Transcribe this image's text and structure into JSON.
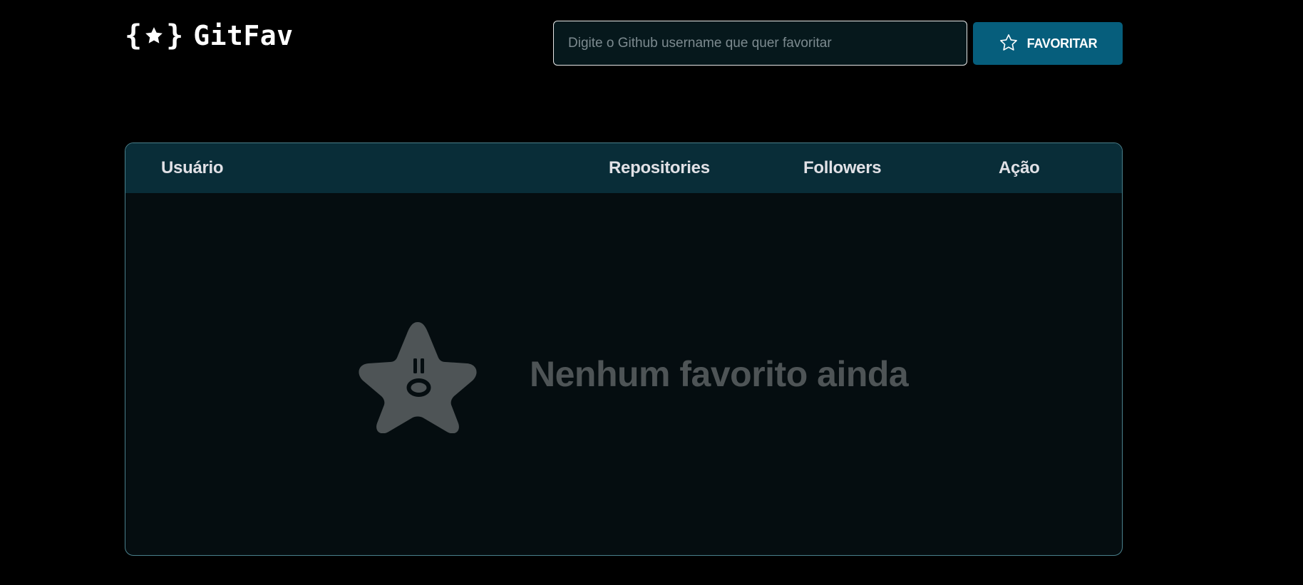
{
  "header": {
    "logo_text": "GitFav",
    "logo_icon": "braces-star-icon",
    "search": {
      "placeholder": "Digite o Github username que quer favoritar",
      "value": ""
    },
    "favorite_button": {
      "label": "FAVORITAR",
      "icon": "star-outline-icon"
    }
  },
  "table": {
    "columns": [
      "Usuário",
      "Repositories",
      "Followers",
      "Ação"
    ],
    "rows": [],
    "empty_state": {
      "icon": "star-face-icon",
      "message": "Nenhum favorito ainda"
    }
  },
  "colors": {
    "background": "#000000",
    "accent": "#065e7c",
    "table_header": "#092d38",
    "table_body": "#050d10",
    "table_border": "#4a808c",
    "empty_text": "#4e5456"
  }
}
